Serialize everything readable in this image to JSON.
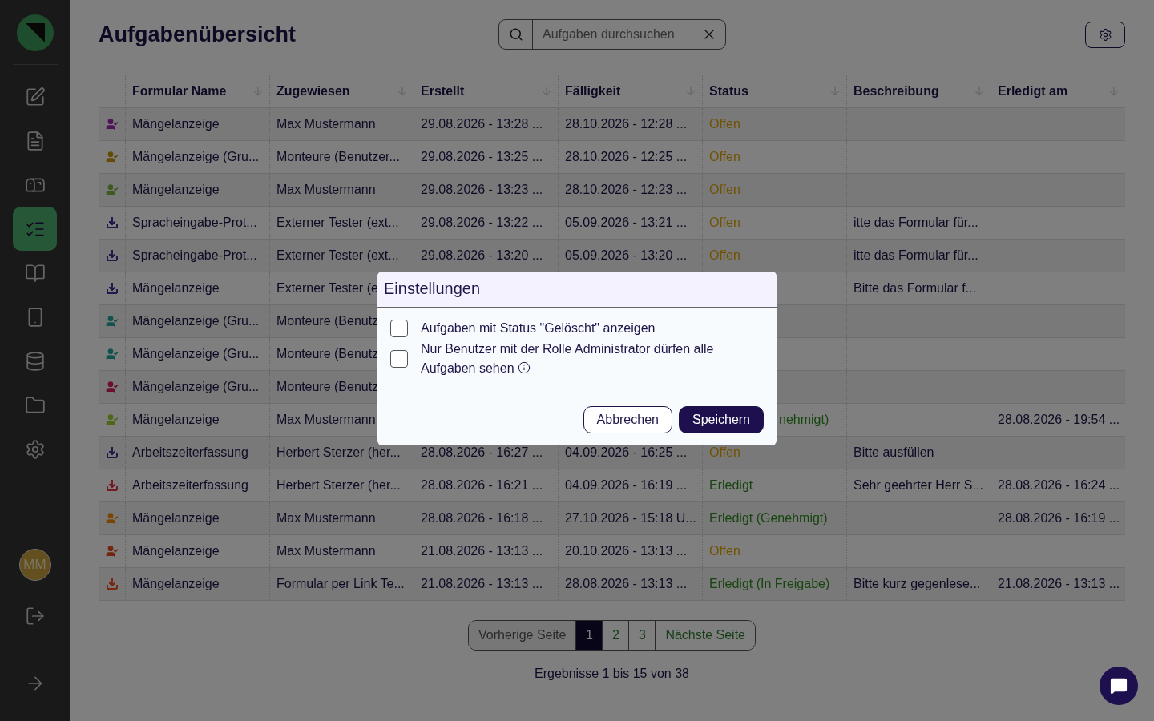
{
  "sidebar": {
    "logo": {
      "kind": "logo"
    },
    "items": [
      {
        "selected": false
      },
      {
        "selected": false
      },
      {
        "selected": false
      },
      {
        "selected": true
      },
      {
        "selected": false
      },
      {
        "selected": false
      },
      {
        "selected": false
      },
      {
        "selected": false
      },
      {
        "selected": false
      }
    ],
    "avatar": "MM"
  },
  "header": {
    "title": "Aufgabenübersicht",
    "search": {
      "placeholder": "Aufgaben durchsuchen"
    }
  },
  "table": {
    "columns": [
      "Formular Name",
      "Zugewiesen",
      "Erstellt",
      "Fälligkeit",
      "Status",
      "Beschreibung",
      "Erledigt am"
    ],
    "rows": [
      {
        "icon": {
          "kind": "user",
          "color": "#4e1458"
        },
        "form": "Mängelanzeige",
        "assignee": "Max Mustermann",
        "created": "29.08.2026 - 13:28 ...",
        "due": "28.10.2026 - 12:28 ...",
        "status": {
          "text": "Offen",
          "kind": "open"
        }
      },
      {
        "icon": {
          "kind": "user",
          "color": "#644b06"
        },
        "form": "Mängelanzeige (Gru...",
        "assignee": "Monteure (Benutzer...",
        "created": "29.08.2026 - 13:25 ...",
        "due": "28.10.2026 - 12:25 ...",
        "status": {
          "text": "Offen",
          "kind": "open"
        }
      },
      {
        "icon": {
          "kind": "user",
          "color": "#3e5a21"
        },
        "form": "Mängelanzeige",
        "assignee": "Max Mustermann",
        "created": "29.08.2026 - 13:23 ...",
        "due": "28.10.2026 - 12:23 ...",
        "status": {
          "text": "Offen",
          "kind": "open"
        }
      },
      {
        "icon": {
          "kind": "inbox",
          "color": "#1e1b4b"
        },
        "form": "Spracheingabe-Prot...",
        "assignee": "Externer Tester (ext...",
        "created": "29.08.2026 - 13:22 ...",
        "due": "05.09.2026 - 13:21 ...",
        "status": {
          "text": "Offen",
          "kind": "open"
        },
        "description": "itte das Formular für..."
      },
      {
        "icon": {
          "kind": "inbox",
          "color": "#1e1b4b"
        },
        "form": "Spracheingabe-Prot...",
        "assignee": "Externer Tester (ext...",
        "created": "29.08.2026 - 13:20 ...",
        "due": "05.09.2026 - 13:20 ...",
        "status": {
          "text": "Offen",
          "kind": "open"
        },
        "description": "itte das Formular für..."
      },
      {
        "icon": {
          "kind": "inbox",
          "color": "#1e1b4b"
        },
        "form": "Mängelanzeige",
        "assignee": "Externer Tester (e",
        "description": "Bitte das Formular f..."
      },
      {
        "icon": {
          "kind": "user",
          "color": "#13534d"
        },
        "form": "Mängelanzeige (Gru...",
        "assignee": "Monteure (Benutz"
      },
      {
        "icon": {
          "kind": "user",
          "color": "#13534d"
        },
        "form": "Mängelanzeige (Gru...",
        "assignee": "Monteure (Benutz"
      },
      {
        "icon": {
          "kind": "user",
          "color": "#6c0e30"
        },
        "form": "Mängelanzeige (Gru...",
        "assignee": "Monteure (Benutz"
      },
      {
        "icon": {
          "kind": "user",
          "color": "#4e6617"
        },
        "form": "Mängelanzeige",
        "assignee": "Max Mustermann",
        "status": {
          "text": "nehmigt)",
          "kind": "done"
        },
        "done_at": "28.08.2026 - 19:54 ..."
      },
      {
        "icon": {
          "kind": "inbox",
          "color": "#1e1b4b"
        },
        "form": "Arbeitszeiterfassung",
        "assignee": "Herbert Sterzer (her...",
        "created": "28.08.2026 - 16:27 ...",
        "due": "04.09.2026 - 16:25 ...",
        "status": {
          "text": "Offen",
          "kind": "open"
        },
        "description": "Bitte ausfüllen"
      },
      {
        "icon": {
          "kind": "inbox",
          "color": "#731c28"
        },
        "form": "Arbeitszeiterfassung",
        "assignee": "Herbert Sterzer (her...",
        "created": "28.08.2026 - 16:21 ...",
        "due": "04.09.2026 - 16:19 ...",
        "status": {
          "text": "Erledigt",
          "kind": "done"
        },
        "description": "Sehr geehrter Herr S...",
        "done_at": "28.08.2026 - 16:24 ..."
      },
      {
        "icon": {
          "kind": "user",
          "color": "#784600"
        },
        "form": "Mängelanzeige",
        "assignee": "Max Mustermann",
        "created": "28.08.2026 - 16:18 ...",
        "due": "27.10.2026 - 15:18 U...",
        "status": {
          "text": "Erledigt (Genehmigt)",
          "kind": "done"
        },
        "done_at": "28.08.2026 - 16:19 ..."
      },
      {
        "icon": {
          "kind": "user",
          "color": "#73250d"
        },
        "form": "Mängelanzeige",
        "assignee": "Max Mustermann",
        "created": "21.08.2026 - 13:13 ...",
        "due": "20.10.2026 - 13:13 ...",
        "status": {
          "text": "Offen",
          "kind": "open"
        }
      },
      {
        "icon": {
          "kind": "inbox",
          "color": "#782815"
        },
        "form": "Mängelanzeige",
        "assignee": "Formular per Link Te...",
        "created": "21.08.2026 - 13:13 ...",
        "due": "28.08.2026 - 13:13 ...",
        "status": {
          "text": "Erledigt (In Freigabe)",
          "kind": "done"
        },
        "description": "Bitte kurz gegenlese...",
        "done_at": "21.08.2026 - 13:13 ..."
      }
    ]
  },
  "pagination": {
    "previous": {
      "label": "Vorherige Seite",
      "disabled": true
    },
    "pages": [
      {
        "label": "1",
        "selected": true
      },
      {
        "label": "2",
        "selected": false
      },
      {
        "label": "3",
        "selected": false
      }
    ],
    "next": {
      "label": "Nächste Seite",
      "disabled": false
    },
    "summary": "Ergebnisse 1 bis 15 von 38"
  },
  "dialog": {
    "title": "Einstellungen",
    "options": [
      {
        "label": "Aufgaben mit Status \"Gelöscht\" anzeigen",
        "checked": false,
        "info": false
      },
      {
        "label": "Nur Benutzer mit der Rolle Administrator dürfen alle Aufgaben sehen",
        "checked": false,
        "info": true
      }
    ],
    "buttons": [
      {
        "label": "Abbrechen",
        "kind": "secondary"
      },
      {
        "label": "Speichern",
        "kind": "primary"
      }
    ]
  }
}
